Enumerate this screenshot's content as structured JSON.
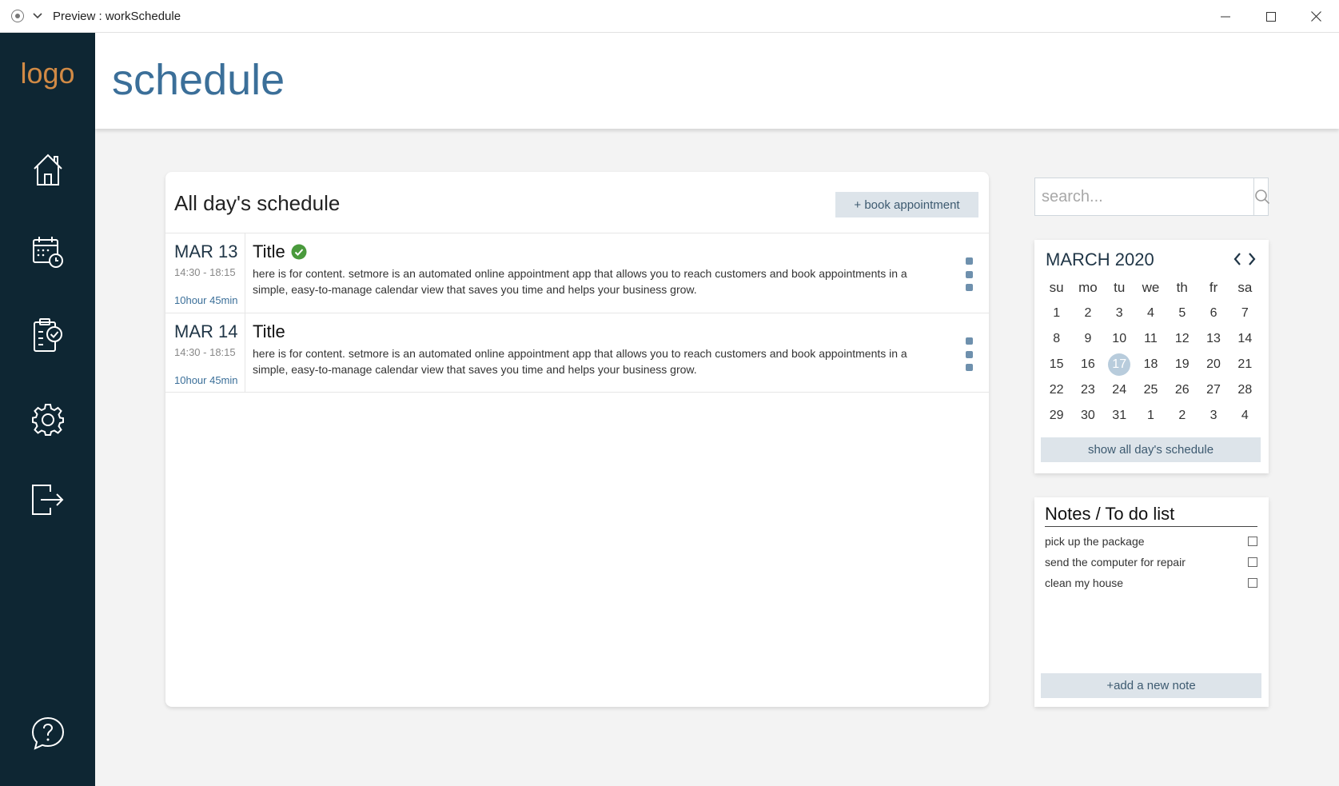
{
  "window": {
    "title": "Preview : workSchedule"
  },
  "sidebar": {
    "logo": "logo",
    "items": [
      {
        "icon": "home-icon"
      },
      {
        "icon": "calendar-clock-icon"
      },
      {
        "icon": "clipboard-check-icon"
      },
      {
        "icon": "gear-icon"
      },
      {
        "icon": "logout-icon"
      },
      {
        "icon": "help-icon"
      }
    ]
  },
  "header": {
    "title": "schedule"
  },
  "schedule": {
    "title": "All day's schedule",
    "book_label": "+ book appointment",
    "items": [
      {
        "date": "MAR 13",
        "time": "14:30 - 18:15",
        "duration": "10hour 45min",
        "title": "Title",
        "completed": true,
        "body": "here is for content. setmore is an automated online appointment app that allows you to reach customers and book appointments in a simple, easy-to-manage calendar view that saves you time and helps your business grow."
      },
      {
        "date": "MAR 14",
        "time": "14:30 - 18:15",
        "duration": "10hour 45min",
        "title": "Title",
        "completed": false,
        "body": "here is for content. setmore is an automated online appointment app that allows you to reach customers and book appointments in a simple, easy-to-manage calendar view that saves you time and helps your business grow."
      }
    ]
  },
  "search": {
    "placeholder": "search..."
  },
  "calendar": {
    "month": "MARCH 2020",
    "weekdays": [
      "su",
      "mo",
      "tu",
      "we",
      "th",
      "fr",
      "sa"
    ],
    "weeks": [
      [
        "1",
        "2",
        "3",
        "4",
        "5",
        "6",
        "7"
      ],
      [
        "8",
        "9",
        "10",
        "11",
        "12",
        "13",
        "14"
      ],
      [
        "15",
        "16",
        "17",
        "18",
        "19",
        "20",
        "21"
      ],
      [
        "22",
        "23",
        "24",
        "25",
        "26",
        "27",
        "28"
      ],
      [
        "29",
        "30",
        "31",
        "1",
        "2",
        "3",
        "4"
      ]
    ],
    "selected": "17",
    "show_all_label": "show all day's schedule"
  },
  "notes": {
    "title": "Notes / To do list",
    "items": [
      {
        "text": "pick up the package",
        "checked": false
      },
      {
        "text": "send the computer for repair",
        "checked": false
      },
      {
        "text": "clean my house",
        "checked": false
      }
    ],
    "add_label": "+add a new note"
  },
  "colors": {
    "sidebar_bg": "#0e2633",
    "logo": "#d18a45",
    "title_blue": "#3b6f99",
    "button_bg": "#dde4ea",
    "check_green": "#4a9a3c"
  }
}
